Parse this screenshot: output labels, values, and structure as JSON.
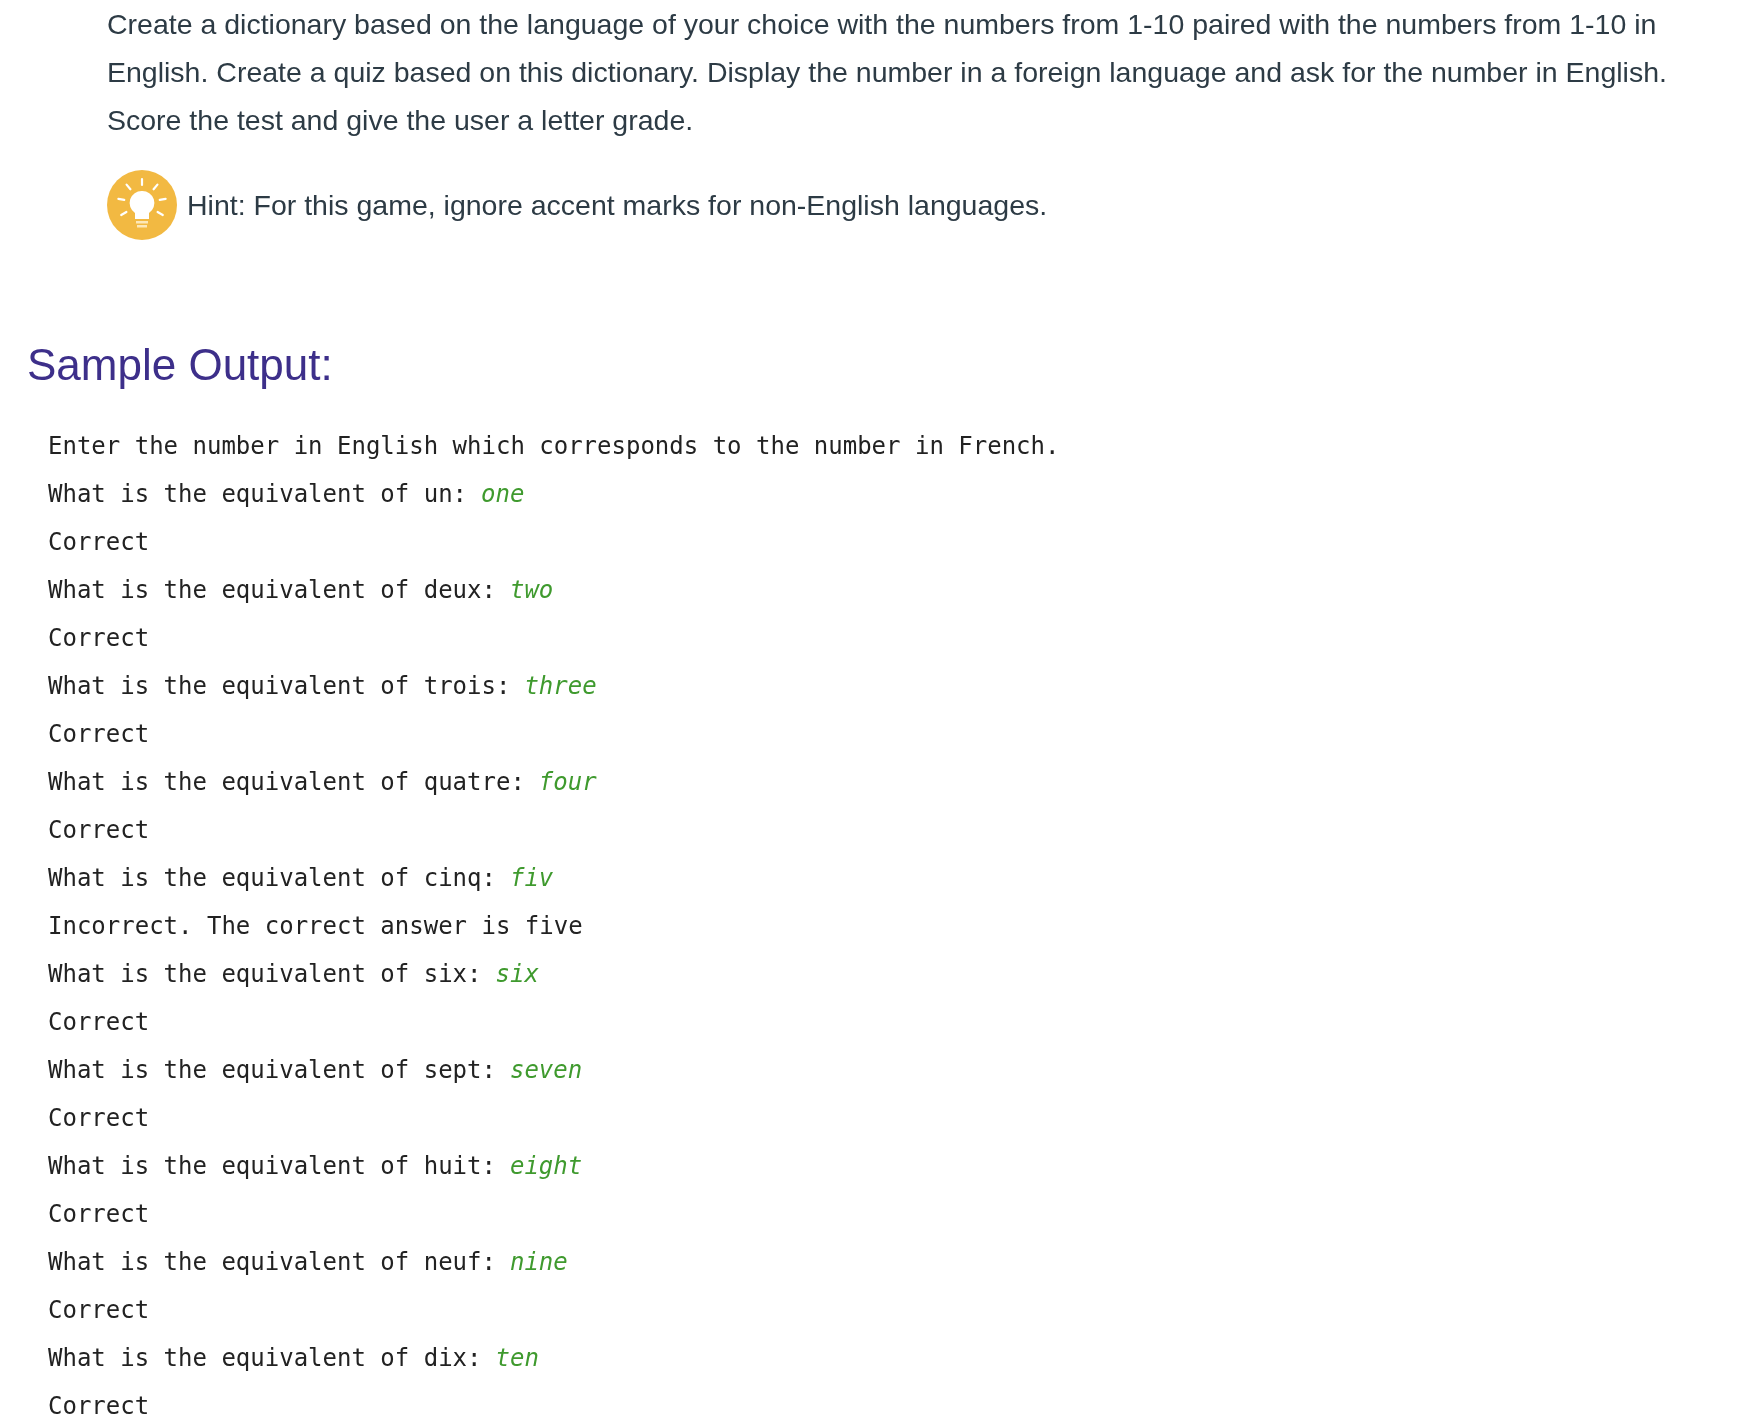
{
  "instructions": "Create a dictionary based on the language of your choice with the numbers from 1-10 paired with the numbers from 1-10 in English. Create a quiz based on this dictionary. Display the number in a foreign language and ask for the number in English. Score the test and give the user a letter grade.",
  "hint": "Hint: For this game, ignore accent marks for non-English languages.",
  "section_heading": "Sample Output:",
  "output_lines": [
    {
      "kind": "plain",
      "text": "Enter the number in English which corresponds to the number in French."
    },
    {
      "kind": "prompt",
      "text": "What is the equivalent of un:",
      "answer": "one"
    },
    {
      "kind": "plain",
      "text": "Correct"
    },
    {
      "kind": "prompt",
      "text": "What is the equivalent of deux:",
      "answer": "two"
    },
    {
      "kind": "plain",
      "text": "Correct"
    },
    {
      "kind": "prompt",
      "text": "What is the equivalent of trois:",
      "answer": "three"
    },
    {
      "kind": "plain",
      "text": "Correct"
    },
    {
      "kind": "prompt",
      "text": "What is the equivalent of quatre:",
      "answer": "four"
    },
    {
      "kind": "plain",
      "text": "Correct"
    },
    {
      "kind": "prompt",
      "text": "What is the equivalent of cinq:",
      "answer": "fiv"
    },
    {
      "kind": "plain",
      "text": "Incorrect. The correct answer is five"
    },
    {
      "kind": "prompt",
      "text": "What is the equivalent of six:",
      "answer": "six"
    },
    {
      "kind": "plain",
      "text": "Correct"
    },
    {
      "kind": "prompt",
      "text": "What is the equivalent of sept:",
      "answer": "seven"
    },
    {
      "kind": "plain",
      "text": "Correct"
    },
    {
      "kind": "prompt",
      "text": "What is the equivalent of huit:",
      "answer": "eight"
    },
    {
      "kind": "plain",
      "text": "Correct"
    },
    {
      "kind": "prompt",
      "text": "What is the equivalent of neuf:",
      "answer": "nine"
    },
    {
      "kind": "plain",
      "text": "Correct"
    },
    {
      "kind": "prompt",
      "text": "What is the equivalent of dix:",
      "answer": "ten"
    },
    {
      "kind": "plain",
      "text": "Correct"
    }
  ]
}
